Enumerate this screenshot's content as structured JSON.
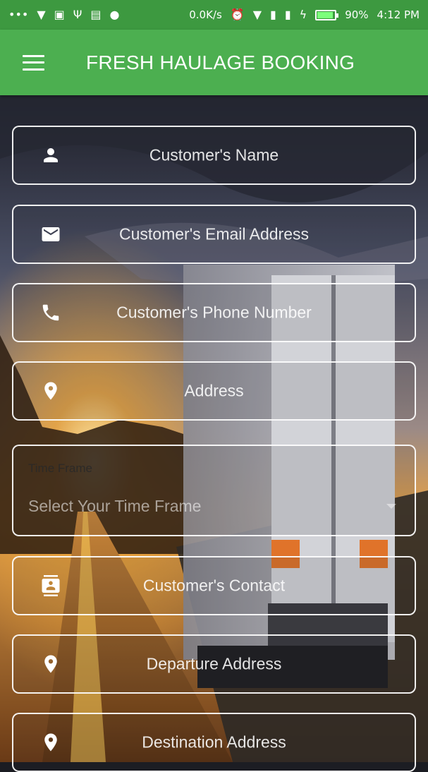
{
  "status_bar": {
    "network_speed": "0.0K/s",
    "battery": "90%",
    "battery_level": 0.9,
    "time": "4:12 PM"
  },
  "app_bar": {
    "title": "FRESH HAULAGE BOOKING",
    "menu_icon": "hamburger-menu-icon"
  },
  "form": {
    "customer_name": {
      "placeholder": "Customer's Name",
      "icon": "person-icon"
    },
    "customer_email": {
      "placeholder": "Customer's Email Address",
      "icon": "email-icon"
    },
    "customer_phone": {
      "placeholder": "Customer's Phone Number",
      "icon": "phone-icon"
    },
    "address": {
      "placeholder": "Address",
      "icon": "location-pin-icon"
    },
    "time_frame": {
      "label": "Time Frame",
      "placeholder": "Select Your Time Frame"
    },
    "customer_contact": {
      "placeholder": "Customer's Contact",
      "icon": "contact-card-icon"
    },
    "departure_address": {
      "placeholder": "Departure Address",
      "icon": "location-pin-icon"
    },
    "destination_address": {
      "placeholder": "Destination Address",
      "icon": "location-pin-icon"
    }
  },
  "colors": {
    "status_bar": "#3d9940",
    "app_bar": "#4caf50",
    "field_border": "#ffffff"
  }
}
